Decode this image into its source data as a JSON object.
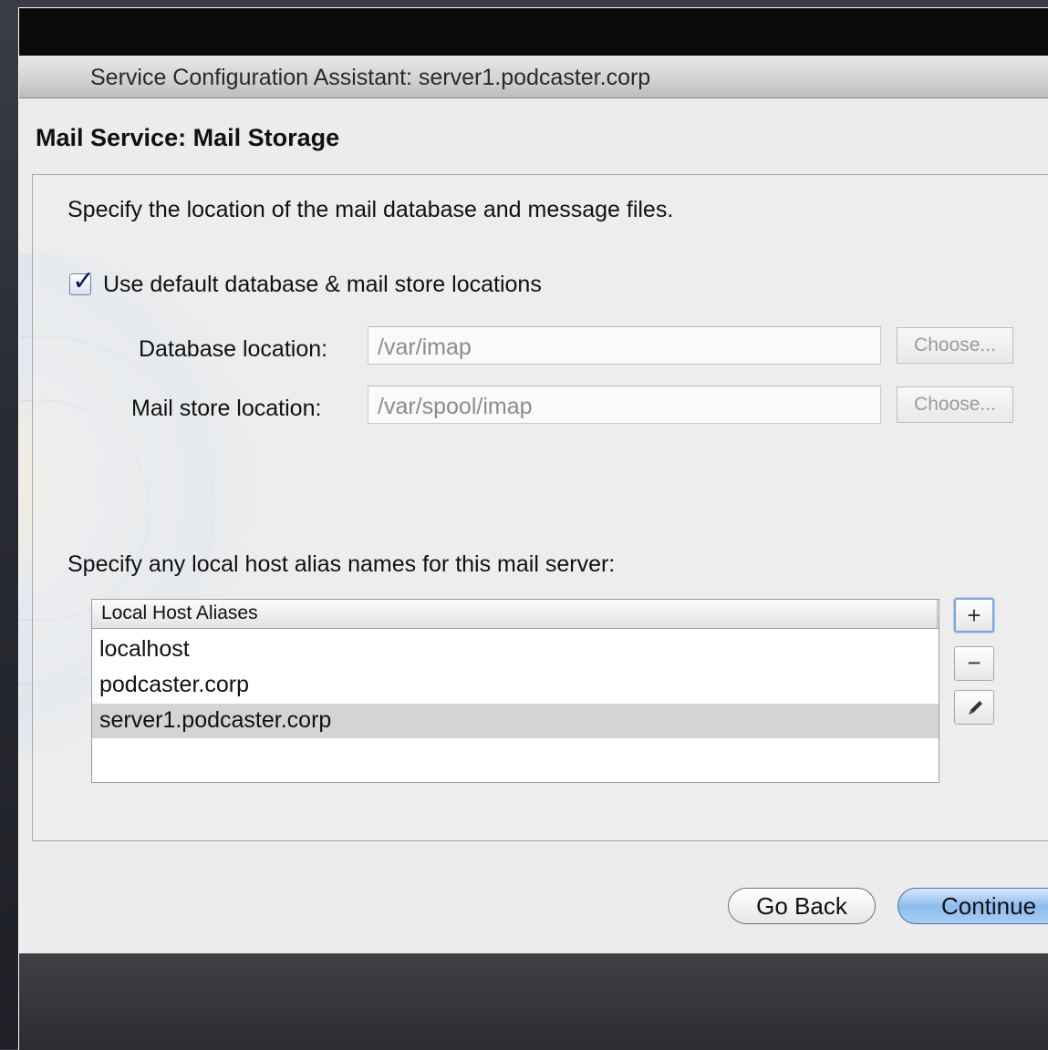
{
  "window": {
    "title": "Service Configuration Assistant: server1.podcaster.corp"
  },
  "page": {
    "section_title": "Mail Service: Mail Storage",
    "intro_text": "Specify the location of the mail database and message files."
  },
  "storage": {
    "use_default_label": "Use default database & mail store locations",
    "use_default_checked": true,
    "checkbox_mark": "✓",
    "database_label": "Database location:",
    "database_value": "/var/imap",
    "mailstore_label": "Mail store location:",
    "mailstore_value": "/var/spool/imap",
    "choose_label": "Choose..."
  },
  "aliases": {
    "prompt": "Specify any local host alias names for this mail server:",
    "column_header": "Local Host Aliases",
    "items": [
      {
        "label": "localhost",
        "selected": false
      },
      {
        "label": "podcaster.corp",
        "selected": false
      },
      {
        "label": "server1.podcaster.corp",
        "selected": true
      }
    ],
    "add_glyph": "+",
    "remove_glyph": "−",
    "edit_icon": "pencil-icon"
  },
  "buttons": {
    "go_back": "Go Back",
    "continue": "Continue"
  },
  "colors": {
    "window_bg": "#ececec",
    "selected_row": "#d4d4d4",
    "default_button": "#8ebcec"
  }
}
